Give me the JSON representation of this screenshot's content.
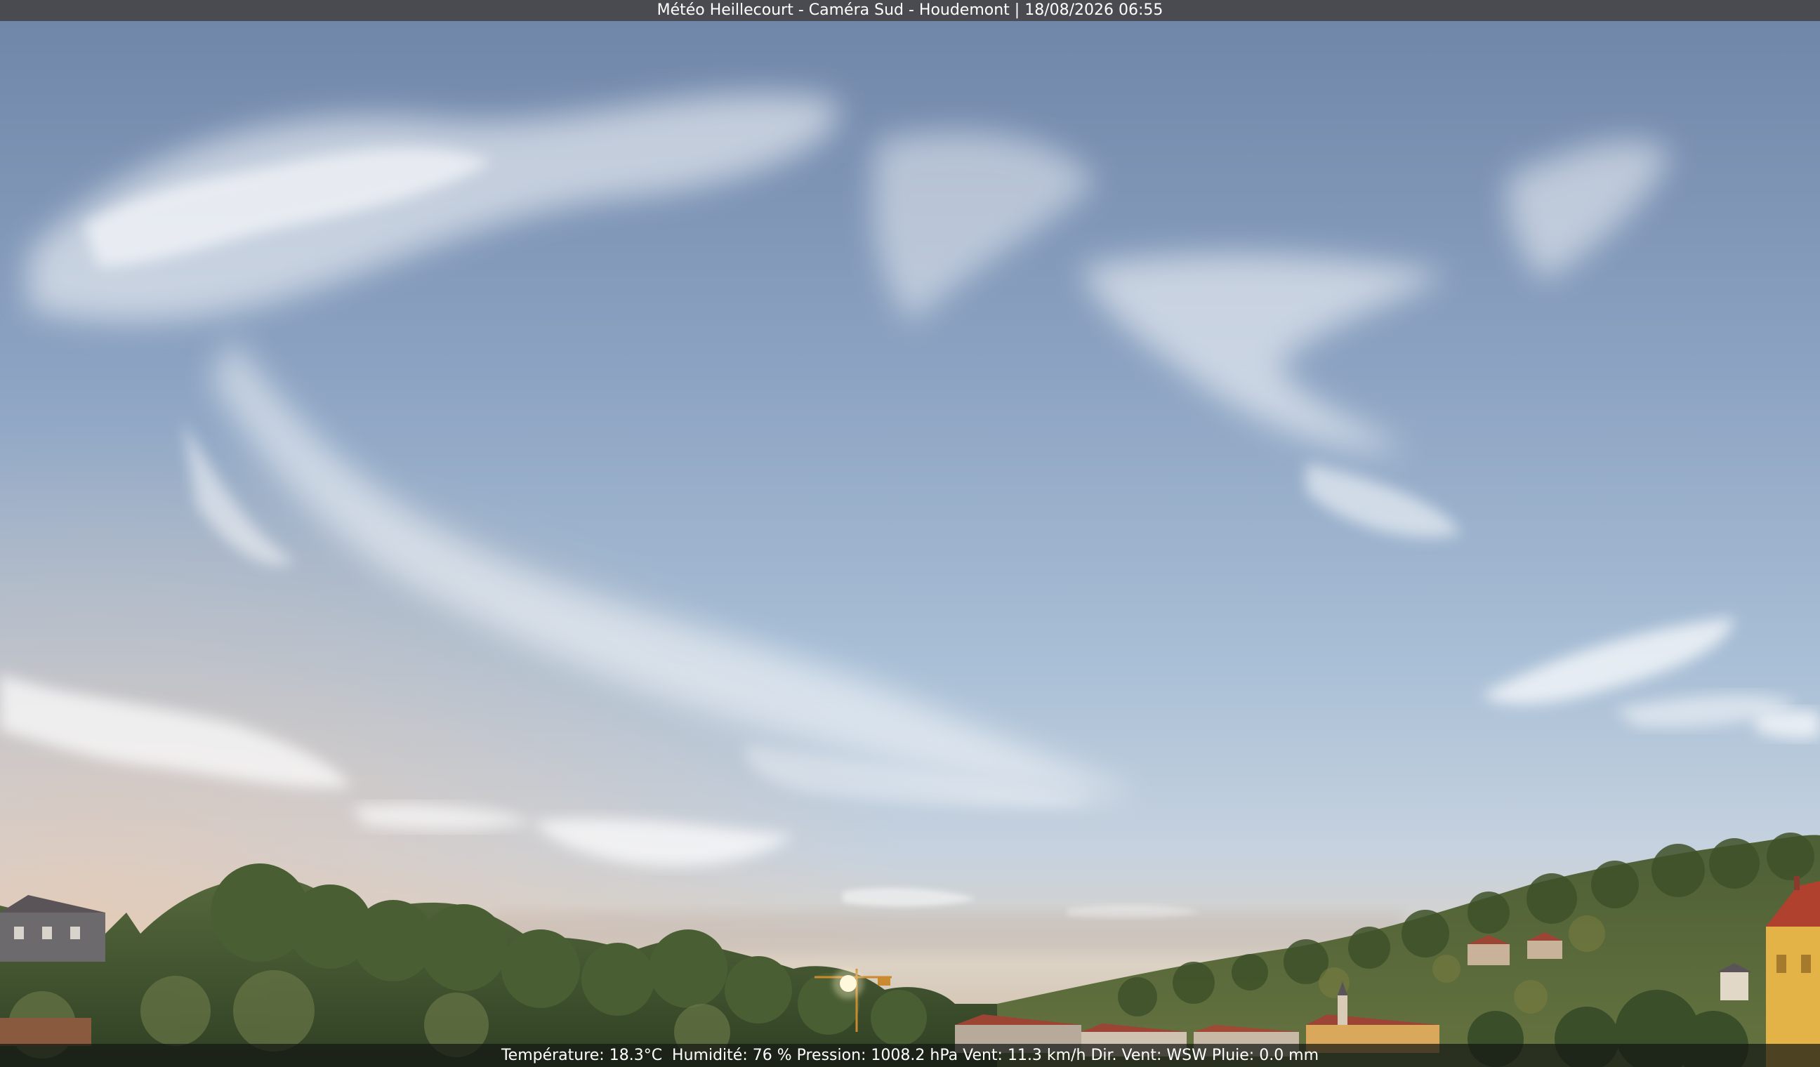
{
  "overlay": {
    "title": "Météo Heillecourt - Caméra Sud - Houdemont | 18/08/2026 06:55",
    "weather": "Température: 18.3°C  Humidité: 76 % Pression: 1008.2 hPa Vent: 11.3 km/h Dir. Vent: WSW Pluie: 0.0 mm"
  },
  "colors": {
    "sky_top": "#6f85a8",
    "sky_mid": "#94aecb",
    "sky_horizon": "#dcd3c6",
    "trees": "#3f5430",
    "building_yellow": "#e3b348",
    "roof_red": "#9c4534"
  }
}
